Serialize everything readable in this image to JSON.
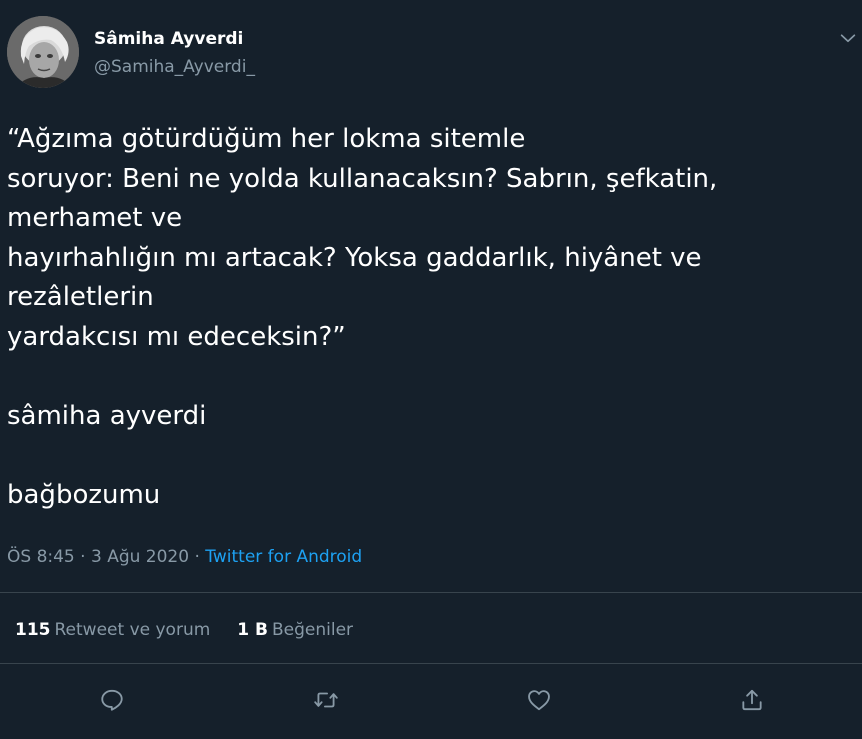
{
  "author": {
    "display_name": "Sâmiha Ayverdi",
    "handle": "@Samiha_Ayverdi_",
    "avatar_icon": "profile-photo"
  },
  "tweet": {
    "lines": [
      "“Ağzıma götürdüğüm her lokma sitemle",
      "soruyor: Beni ne yolda kullanacaksın? Sabrın, şefkatin,",
      "merhamet ve",
      "hayırhahlığın mı artacak? Yoksa gaddarlık, hiyânet ve",
      "rezâletlerin",
      "yardakcısı mı edeceksin?”",
      "",
      "sâmiha ayverdi",
      "",
      "bağbozumu"
    ],
    "time": "ÖS 8:45",
    "date": "3 Ağu 2020",
    "source": "Twitter for Android"
  },
  "stats": {
    "retweets_count": "115",
    "retweets_label": "Retweet ve yorum",
    "likes_count": "1 B",
    "likes_label": "Beğeniler"
  },
  "actions": {
    "reply_icon": "reply-icon",
    "retweet_icon": "retweet-icon",
    "like_icon": "heart-icon",
    "share_icon": "share-icon"
  },
  "colors": {
    "background": "#15202b",
    "text": "#ffffff",
    "secondary": "#8899a6",
    "link": "#1da1f2",
    "divider": "#38444d"
  }
}
